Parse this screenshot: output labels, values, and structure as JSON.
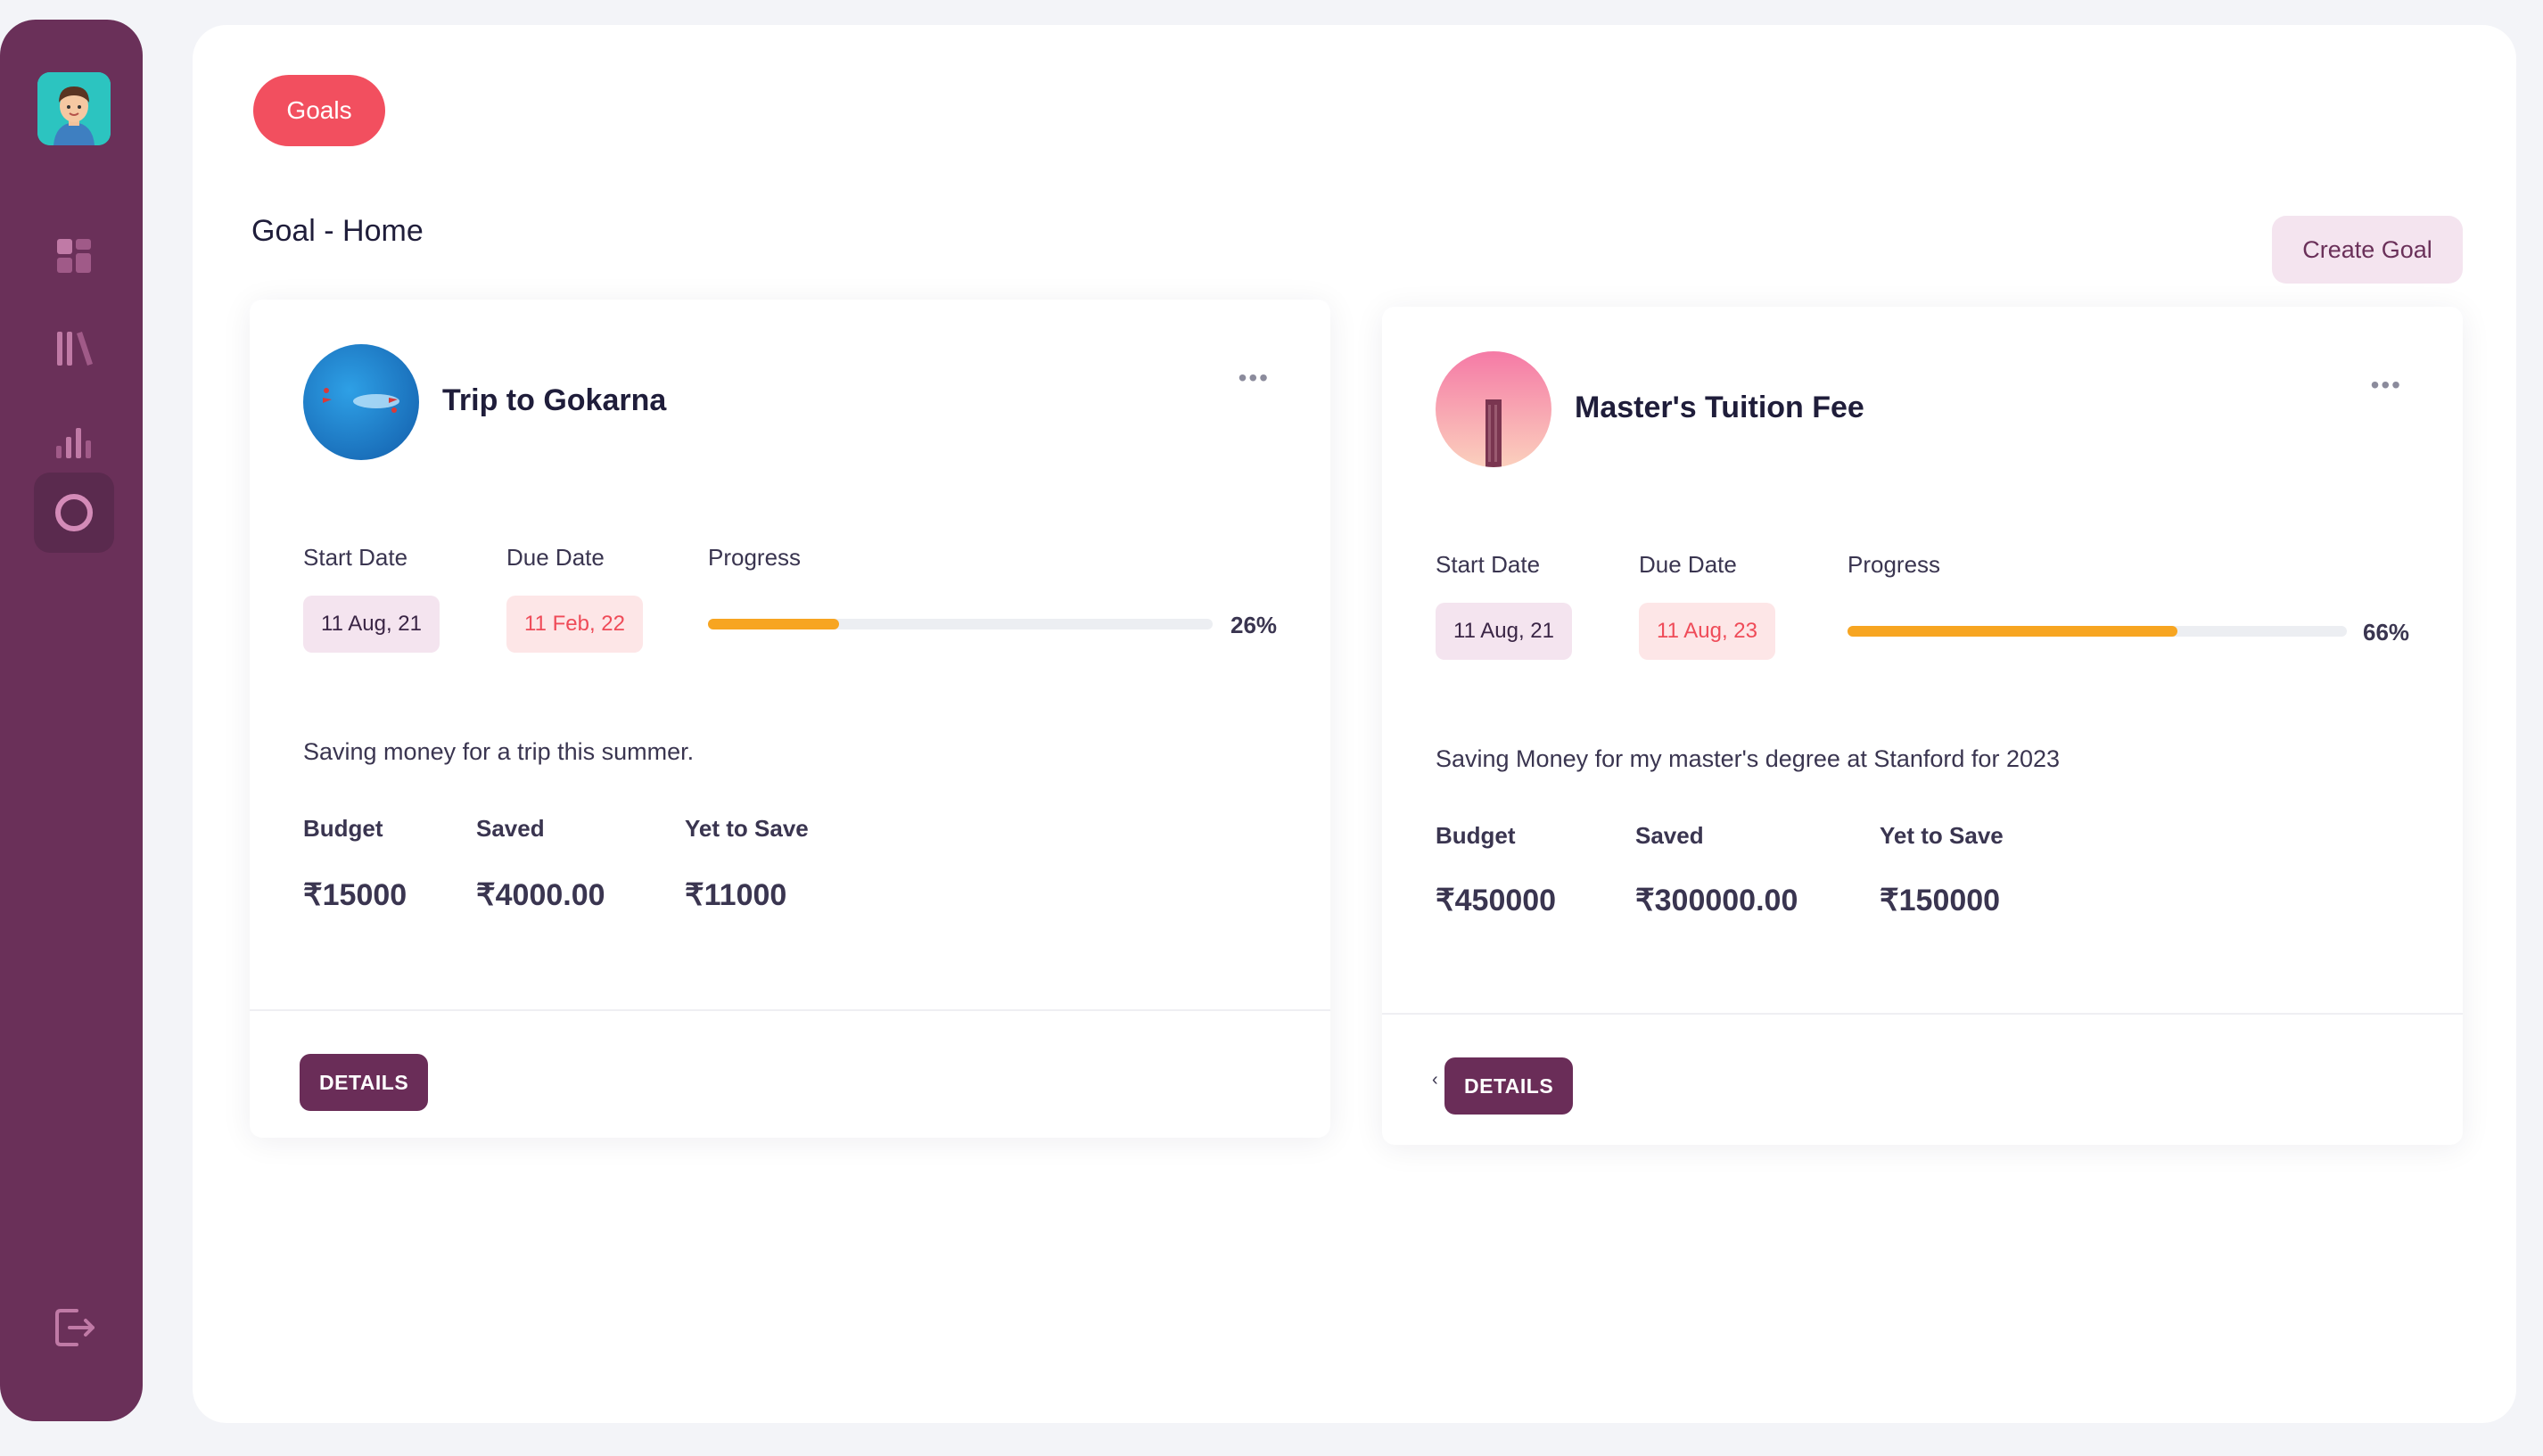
{
  "sidebar": {
    "nav": [
      {
        "icon": "dashboard-icon"
      },
      {
        "icon": "library-icon"
      },
      {
        "icon": "chart-icon"
      },
      {
        "icon": "goals-circle-icon",
        "active": true
      }
    ],
    "logout_icon": "logout-icon"
  },
  "header": {
    "pill_label": "Goals",
    "page_title": "Goal - Home",
    "create_label": "Create Goal"
  },
  "labels": {
    "start_date": "Start Date",
    "due_date": "Due Date",
    "progress": "Progress",
    "budget": "Budget",
    "saved": "Saved",
    "yet_to_save": "Yet to Save",
    "details": "DETAILS",
    "menu": "•••"
  },
  "goals": [
    {
      "title": "Trip to Gokarna",
      "start": "11 Aug, 21",
      "due": "11 Feb, 22",
      "progress": 26,
      "progress_label": "26%",
      "description": "Saving money for a trip this summer.",
      "budget": "₹15000",
      "saved": "₹4000.00",
      "yet": "₹11000"
    },
    {
      "title": "Master's Tuition Fee",
      "start": "11 Aug, 21",
      "due": "11 Aug, 23",
      "progress": 66,
      "progress_label": "66%",
      "description": "Saving Money for my master's degree at Stanford for 2023",
      "budget": "₹450000",
      "saved": "₹300000.00",
      "yet": "₹150000"
    }
  ],
  "colors": {
    "sidebar": "#6a3059",
    "accent_pill": "#f24f5f",
    "progress": "#f7a521",
    "details_button": "#6a2d58"
  }
}
